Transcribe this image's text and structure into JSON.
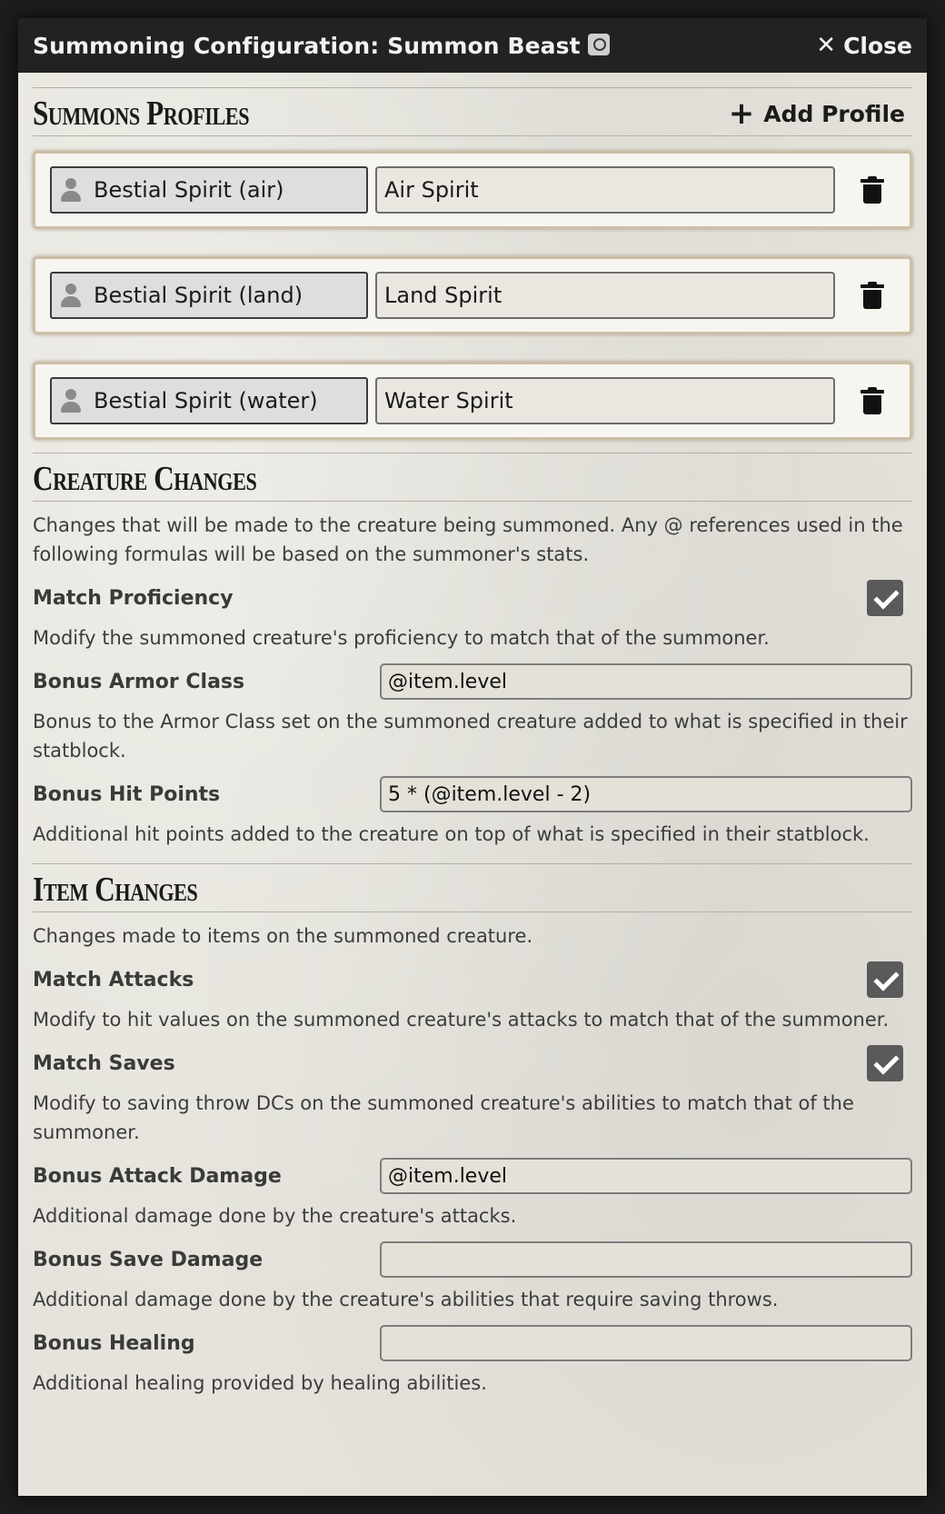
{
  "window": {
    "title": "Summoning Configuration: Summon Beast",
    "close_label": "Close"
  },
  "profiles_section": {
    "title": "Summons Profiles",
    "add_label": "Add Profile",
    "profiles": [
      {
        "actor": "Bestial Spirit (air)",
        "name": "Air Spirit"
      },
      {
        "actor": "Bestial Spirit (land)",
        "name": "Land Spirit"
      },
      {
        "actor": "Bestial Spirit (water)",
        "name": "Water Spirit"
      }
    ]
  },
  "creature_changes": {
    "title": "Creature Changes",
    "hint": "Changes that will be made to the creature being summoned. Any @ references used in the following formulas will be based on the summoner's stats.",
    "match_proficiency": {
      "label": "Match Proficiency",
      "checked": true,
      "hint": "Modify the summoned creature's proficiency to match that of the summoner."
    },
    "bonus_ac": {
      "label": "Bonus Armor Class",
      "value": "@item.level",
      "hint": "Bonus to the Armor Class set on the summoned creature added to what is specified in their statblock."
    },
    "bonus_hp": {
      "label": "Bonus Hit Points",
      "value": "5 * (@item.level - 2)",
      "hint": "Additional hit points added to the creature on top of what is specified in their statblock."
    }
  },
  "item_changes": {
    "title": "Item Changes",
    "hint": "Changes made to items on the summoned creature.",
    "match_attacks": {
      "label": "Match Attacks",
      "checked": true,
      "hint": "Modify to hit values on the summoned creature's attacks to match that of the summoner."
    },
    "match_saves": {
      "label": "Match Saves",
      "checked": true,
      "hint": "Modify to saving throw DCs on the summoned creature's abilities to match that of the summoner."
    },
    "bonus_attack_damage": {
      "label": "Bonus Attack Damage",
      "value": "@item.level",
      "hint": "Additional damage done by the creature's attacks."
    },
    "bonus_save_damage": {
      "label": "Bonus Save Damage",
      "value": "",
      "hint": "Additional damage done by the creature's abilities that require saving throws."
    },
    "bonus_healing": {
      "label": "Bonus Healing",
      "value": "",
      "hint": "Additional healing provided by healing abilities."
    }
  },
  "icons": {
    "title_badge": "compendium-icon",
    "close": "close-icon",
    "add": "plus-icon",
    "actor": "person-icon",
    "delete": "trash-icon",
    "check": "checkmark-icon"
  },
  "colors": {
    "titlebar": "#222222",
    "panel": "#e5e3db",
    "checkbox": "#5a5a5a",
    "profile_border": "#cbbfa6"
  }
}
